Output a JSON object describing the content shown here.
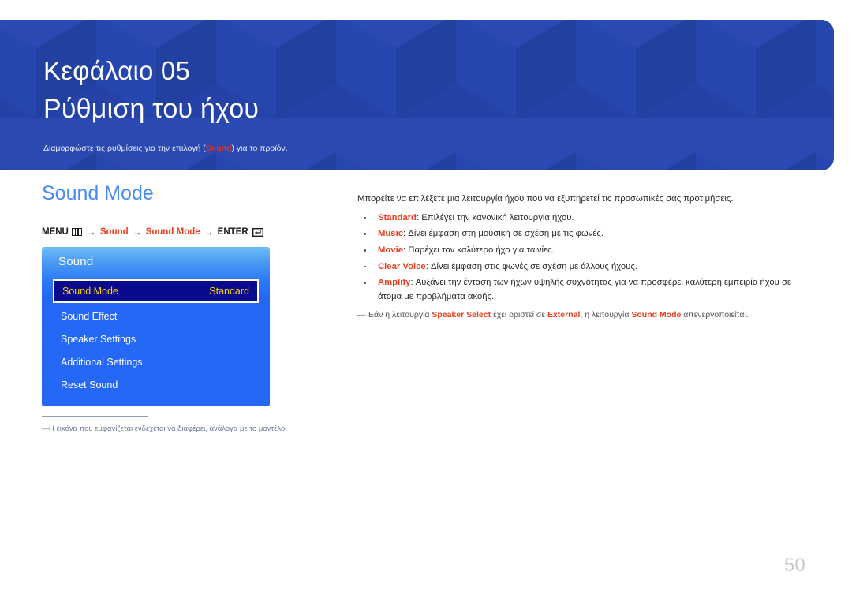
{
  "banner": {
    "chapter_label": "Κεφάλαιο 05",
    "chapter_title": "Ρύθμιση του ήχου",
    "subtitle_before": "Διαμορφώστε τις ρυθμίσεις για την επιλογή (",
    "subtitle_highlight": "Sound",
    "subtitle_after": ") για το προϊόν.",
    "bg_color": "#2442a8",
    "highlight_color": "#e03020"
  },
  "left": {
    "section_heading": "Sound Mode",
    "section_heading_color": "#4a8cf0",
    "menu_path": {
      "menu_label": "MENU",
      "menu_icon": "menu-grid-icon",
      "arrow": "→",
      "step1": "Sound",
      "step2": "Sound Mode",
      "enter_label": "ENTER",
      "enter_icon": "enter-return-icon",
      "accent_color": "#e8401f"
    },
    "osd": {
      "title": "Sound",
      "items": [
        {
          "label": "Sound Mode",
          "value": "Standard",
          "selected": true
        },
        {
          "label": "Sound Effect",
          "value": "",
          "selected": false
        },
        {
          "label": "Speaker Settings",
          "value": "",
          "selected": false
        },
        {
          "label": "Additional Settings",
          "value": "",
          "selected": false
        },
        {
          "label": "Reset Sound",
          "value": "",
          "selected": false
        }
      ],
      "selected_bg": "#0a0a8c",
      "selected_text": "#ffd400"
    },
    "footnote": {
      "dash": "―",
      "text": "Η εικόνα που εμφανίζεται ενδέχεται να διαφέρει, ανάλογα με το μοντέλο."
    }
  },
  "right": {
    "intro": "Μπορείτε να επιλέξετε μια λειτουργία ήχου που να εξυπηρετεί τις προσωπικές σας προτιμήσεις.",
    "bullets": [
      {
        "term": "Standard",
        "sep": ": ",
        "text": "Επιλέγει την κανονική λειτουργία ήχου."
      },
      {
        "term": "Music",
        "sep": ": ",
        "text": "Δίνει έμφαση στη μουσική σε σχέση με τις φωνές."
      },
      {
        "term": "Movie",
        "sep": ": ",
        "text": "Παρέχει τον καλύτερο ήχο για ταινίες."
      },
      {
        "term": "Clear Voice",
        "sep": ": ",
        "text": "Δίνει έμφαση στις φωνές σε σχέση με άλλους ήχους."
      },
      {
        "term": "Amplify",
        "sep": ": ",
        "text": "Αυξάνει την ένταση των ήχων υψηλής συχνότητας για να προσφέρει καλύτερη εμπειρία ήχου σε άτομα με προβλήματα ακοής."
      }
    ],
    "note": {
      "emdash": "―",
      "part1": "Εάν η λειτουργία ",
      "term1": "Speaker Select",
      "part2": " έχει οριστεί σε ",
      "term2": "External",
      "part3": ", η λειτουργία ",
      "term3": "Sound Mode",
      "part4": " απενεργοποιείται."
    }
  },
  "page_number": "50"
}
